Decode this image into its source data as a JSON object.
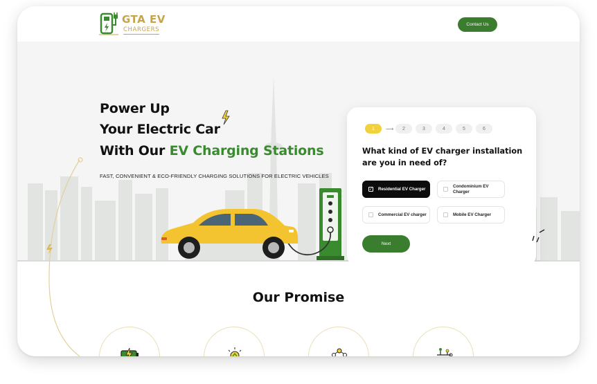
{
  "header": {
    "logo_title": "GTA EV",
    "logo_sub": "CHARGERS",
    "contact_label": "Contact Us"
  },
  "hero": {
    "line1": "Power Up",
    "line2": "Your Electric Car",
    "line3_prefix": "With Our ",
    "line3_highlight": "EV Charging Stations",
    "subtitle": "FAST, CONVENIENT & ECO-FRIENDLY CHARGING SOLUTIONS FOR ELECTRIC VEHICLES"
  },
  "quiz": {
    "steps": [
      "1",
      "2",
      "3",
      "4",
      "5",
      "6"
    ],
    "active_step": "1",
    "question": "What kind of EV charger installation are you in need of?",
    "options": [
      {
        "label": "Residential EV Charger",
        "selected": true
      },
      {
        "label": "Condominium EV Charger",
        "selected": false
      },
      {
        "label": "Commercial EV charger",
        "selected": false
      },
      {
        "label": "Mobile EV Charger",
        "selected": false
      }
    ],
    "next_label": "Next"
  },
  "promise": {
    "title": "Our Promise",
    "icons": [
      "battery-charging-icon",
      "eco-bulb-icon",
      "people-network-icon",
      "circuit-icon"
    ]
  },
  "colors": {
    "brand_green": "#3a7d2e",
    "highlight_green": "#3a8a2f",
    "gold": "#c5a44a",
    "step_active": "#f1d13c",
    "car_yellow": "#f4c430"
  }
}
